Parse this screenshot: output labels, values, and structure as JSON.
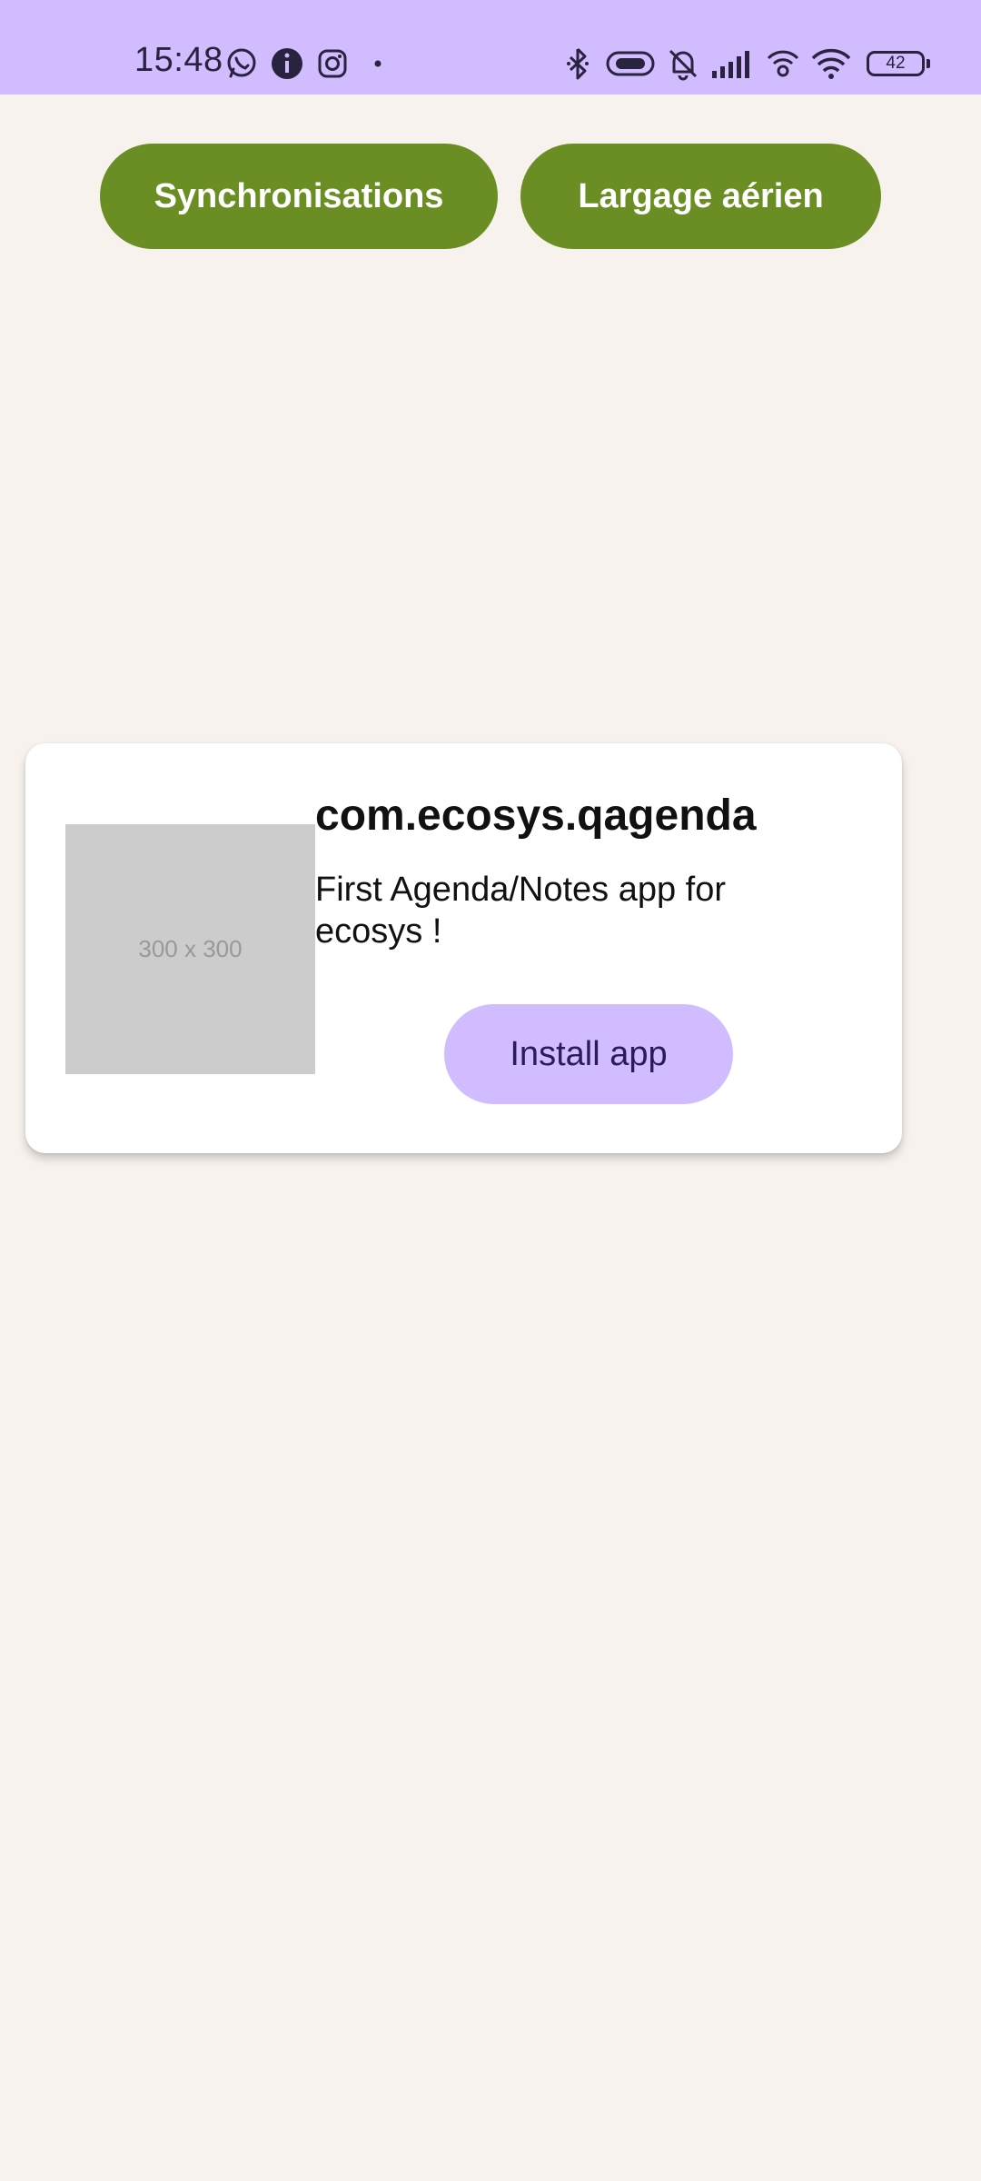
{
  "status_bar": {
    "time": "15:48",
    "battery_level": "42",
    "icons_left": [
      "whatsapp-icon",
      "info-icon",
      "instagram-icon",
      "dot-icon"
    ],
    "icons_right": [
      "bluetooth-icon",
      "vibrate-icon",
      "bell-off-icon",
      "signal-icon",
      "hotspot-icon",
      "wifi-icon",
      "battery-icon"
    ]
  },
  "top_buttons": {
    "sync_label": "Synchronisations",
    "airdrop_label": "Largage aérien"
  },
  "card": {
    "image_placeholder": "300 x 300",
    "app_name": "com.ecosys.qagenda",
    "description": "First Agenda/Notes app for ecosys !",
    "install_label": "Install app"
  },
  "colors": {
    "status_bar_bg": "#D0BCFF",
    "page_bg": "#F7F2EE",
    "primary_button": "#6A8E23",
    "install_button": "#D0BCFF",
    "install_text": "#2A1A5E"
  }
}
